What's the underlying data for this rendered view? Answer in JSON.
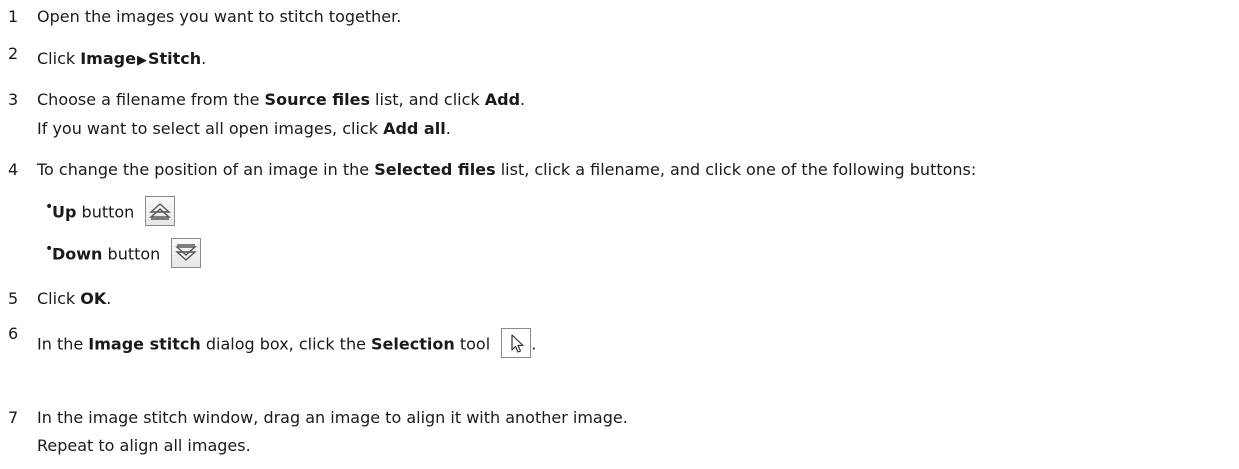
{
  "steps": [
    {
      "num": "1",
      "text": "Open the images you want to stitch together."
    },
    {
      "num": "2",
      "pre": "Click ",
      "menu1": "Image",
      "sep": "▶",
      "menu2": "Stitch",
      "post": "."
    },
    {
      "num": "3",
      "pre": "Choose a filename from the ",
      "b1": "Source files",
      "mid": " list, and click ",
      "b2": "Add",
      "post": ".",
      "sub_pre": "If you want to select all open images, click ",
      "sub_b": "Add all",
      "sub_post": "."
    },
    {
      "num": "4",
      "pre": "To change the position of an image in the ",
      "b1": "Selected files",
      "post": " list, click a filename, and click one of the following buttons:",
      "bullets": [
        {
          "b": "Up",
          "text": " button",
          "icon": "up-arrow-icon"
        },
        {
          "b": "Down",
          "text": " button",
          "icon": "down-arrow-icon"
        }
      ]
    },
    {
      "num": "5",
      "pre": "Click ",
      "b1": "OK",
      "post": "."
    },
    {
      "num": "6",
      "pre": "In the ",
      "b1": "Image stitch",
      "mid": " dialog box, click the ",
      "b2": "Selection",
      "post": " tool",
      "icon": "selection-pointer-icon",
      "tail": "."
    },
    {
      "num": "7",
      "text": "In the image stitch window, drag an image to align it with another image.",
      "sub": "Repeat to align all images."
    }
  ]
}
